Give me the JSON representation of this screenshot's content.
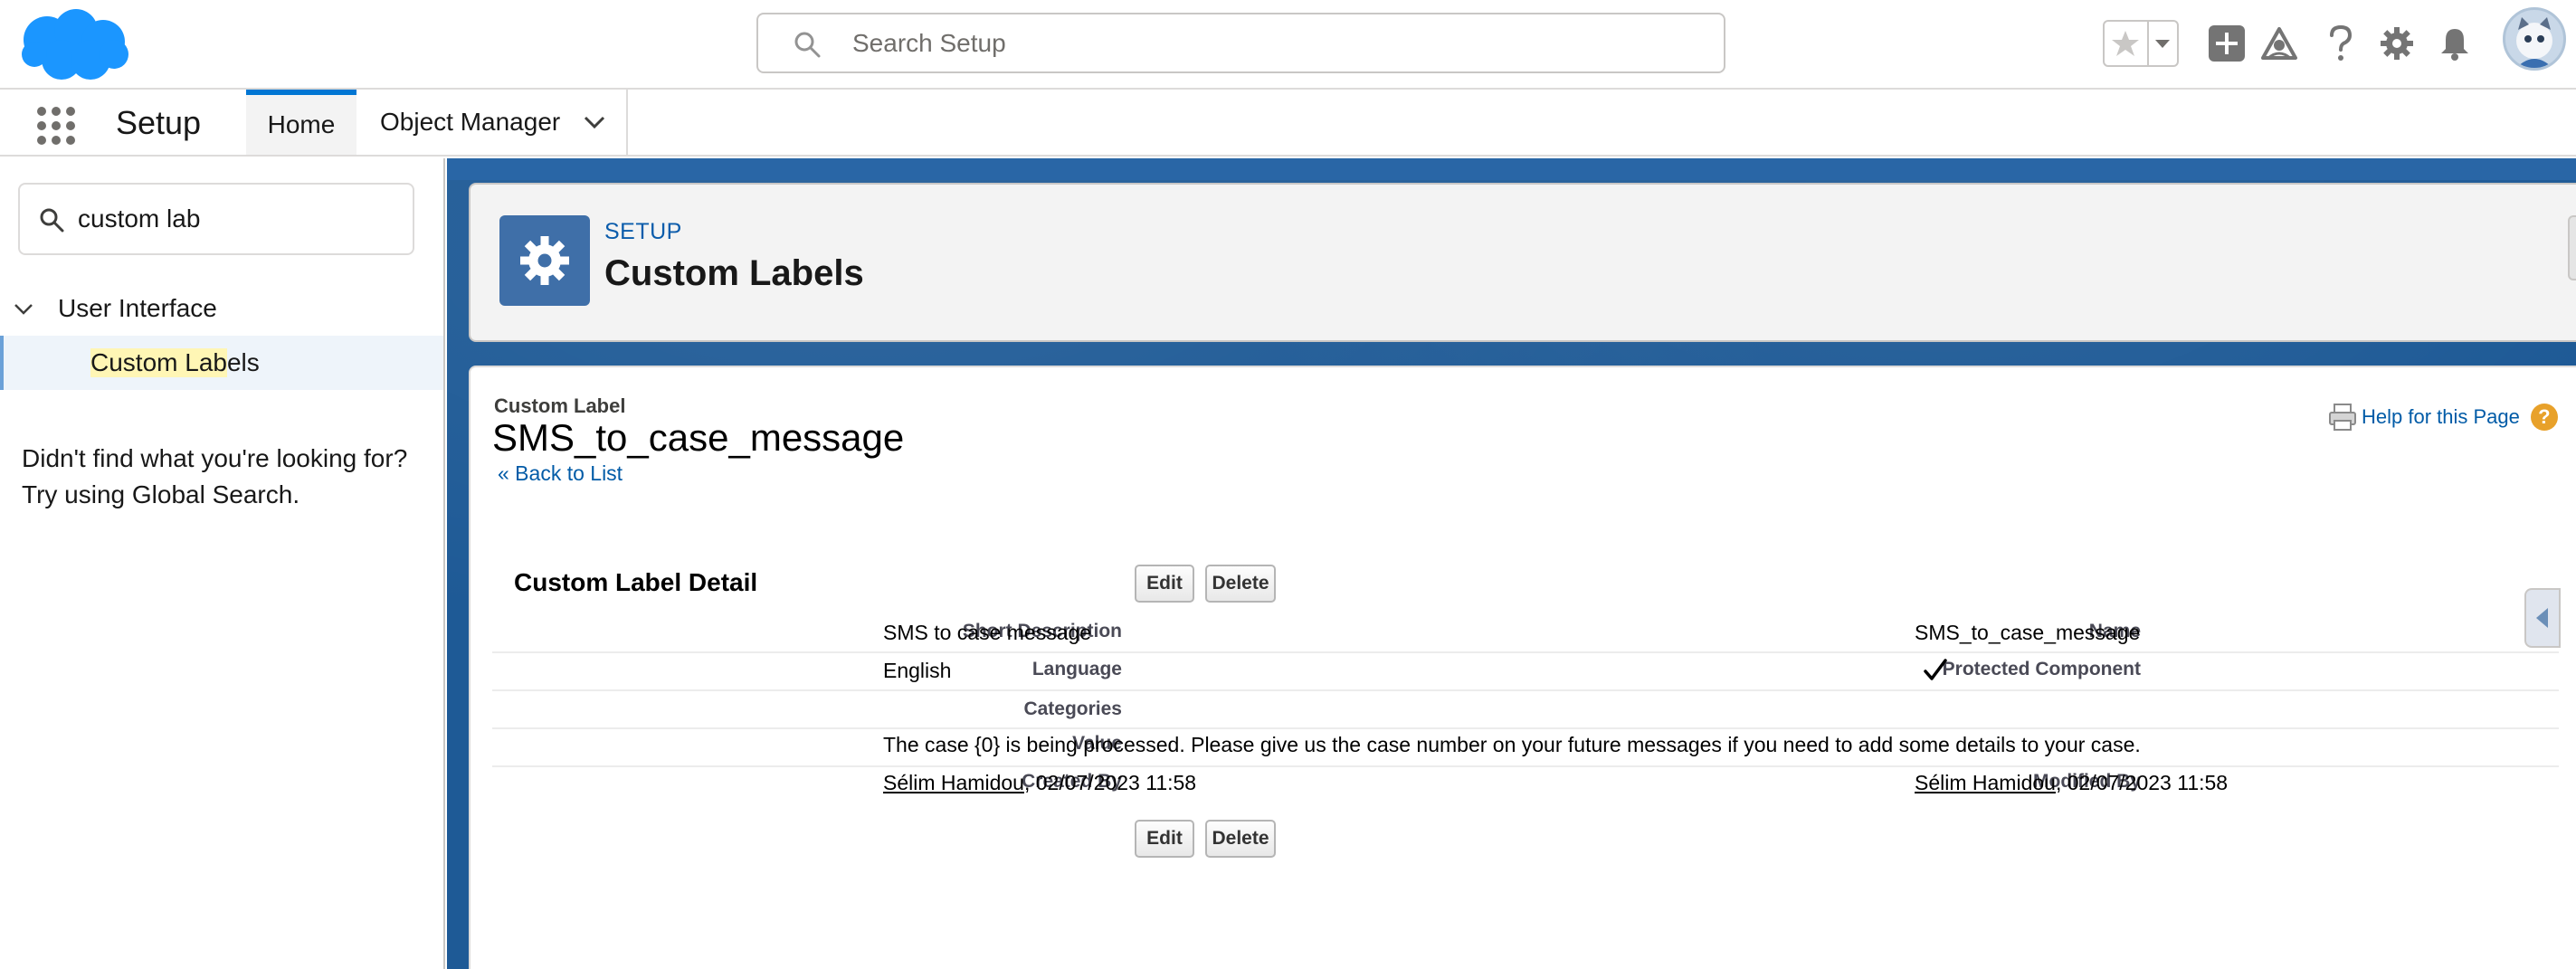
{
  "header": {
    "search_placeholder": "Search Setup",
    "icons": [
      "favorites-star-icon",
      "add-icon",
      "trailhead-icon",
      "help-icon",
      "settings-gear-icon",
      "notifications-bell-icon",
      "avatar"
    ]
  },
  "nav": {
    "app_name": "Setup",
    "tabs": [
      {
        "label": "Home",
        "active": true
      },
      {
        "label": "Object Manager",
        "active": false
      }
    ]
  },
  "sidebar": {
    "quick_find_value": "custom lab",
    "tree": {
      "section": "User Interface",
      "item_match": "Custom Lab",
      "item_rest": "els"
    },
    "not_found_line1": "Didn't find what you're looking for?",
    "not_found_line2": "Try using Global Search."
  },
  "page_header": {
    "kicker": "SETUP",
    "title": "Custom Labels"
  },
  "record": {
    "type_label": "Custom Label",
    "name": "SMS_to_case_message",
    "back_link": "« Back to List",
    "help_link": "Help for this Page",
    "section_title": "Custom Label Detail",
    "buttons": {
      "edit": "Edit",
      "delete": "Delete"
    },
    "fields": {
      "short_description": {
        "label": "Short Description",
        "value": "SMS to case message"
      },
      "name": {
        "label": "Name",
        "value": "SMS_to_case_message"
      },
      "language": {
        "label": "Language",
        "value": "English"
      },
      "protected_component": {
        "label": "Protected Component",
        "checked": true
      },
      "categories": {
        "label": "Categories",
        "value": ""
      },
      "value": {
        "label": "Value",
        "value": "The case {0} is being processed. Please give us the case number on your future messages if you need to add some details to your case."
      },
      "created_by": {
        "label": "Created By",
        "user": "Sélim Hamidou",
        "date": ", 02/07/2023 11:58"
      },
      "modified_by": {
        "label": "Modified By",
        "user": "Sélim Hamidou",
        "date": ", 02/07/2023 11:58"
      }
    }
  },
  "colors": {
    "brand_blue": "#1b96ff",
    "link": "#015ba7",
    "header_icon": "#3f6fa8",
    "banner": "#1e5a96"
  }
}
